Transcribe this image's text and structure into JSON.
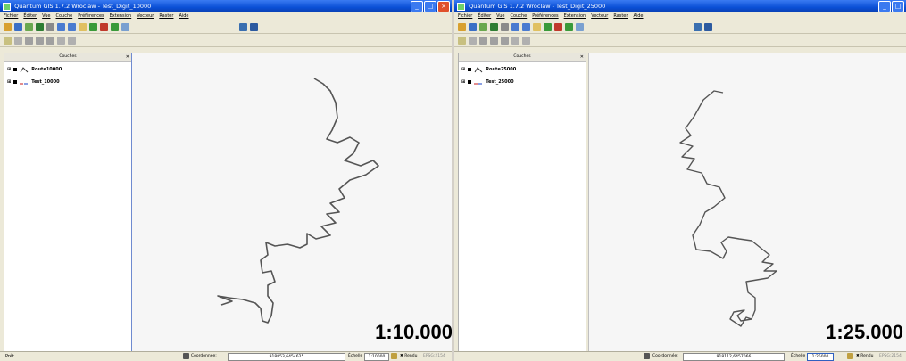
{
  "windows": [
    {
      "title": "Quantum GIS 1.7.2 Wroclaw - Test_Digit_10000",
      "menu": [
        "Fichier",
        "Éditer",
        "Vue",
        "Couche",
        "Préférences",
        "Extension",
        "Vecteur",
        "Raster",
        "Aide"
      ],
      "legend_title": "Couches",
      "layers": [
        "Route10000",
        "Test_10000"
      ],
      "status": "Prêt",
      "coord_label": "Coordonnée:",
      "coord_value": "918853,6454625",
      "scale_label": "Échelle",
      "scale_value": "1:10000",
      "render_label": "Rendu",
      "epsg": "EPSG:2154",
      "big_scale": "1:10.000"
    },
    {
      "title": "Quantum GIS 1.7.2 Wroclaw - Test_Digit_25000",
      "menu": [
        "Fichier",
        "Éditer",
        "Vue",
        "Couche",
        "Préférences",
        "Extension",
        "Vecteur",
        "Raster",
        "Aide"
      ],
      "legend_title": "Couches",
      "layers": [
        "Route25000",
        "Test_25000"
      ],
      "status": "",
      "coord_label": "Coordonnée:",
      "coord_value": "918112,6457066",
      "scale_label": "Échelle",
      "scale_value": "1:25000",
      "render_label": "Rendu",
      "epsg": "EPSG:2154",
      "big_scale": "1:25.000"
    }
  ],
  "colors": {
    "titlebar": "#0a4fd6",
    "line": "#555555",
    "map_bg": "#f6f6f6"
  }
}
